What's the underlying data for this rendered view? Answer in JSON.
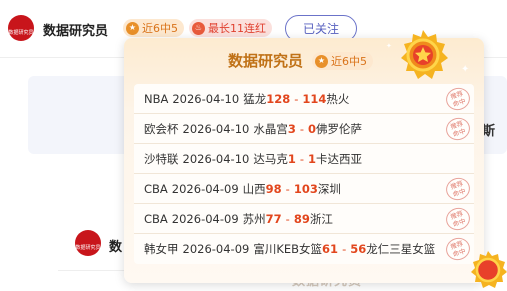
{
  "header": {
    "avatar_text": "数据研究员",
    "name": "数据研究员",
    "badge_win": "近6中5",
    "badge_streak": "最长11连红",
    "follow_label": "已关注"
  },
  "background": {
    "cut_text": "斯"
  },
  "popup": {
    "title": "数据研究员",
    "badge": "近6中5",
    "items": [
      {
        "league": "NBA",
        "date": "2026-04-10",
        "home": "猛龙",
        "hs": "128",
        "as": "114",
        "away": "热火",
        "stamp": "推荐命中"
      },
      {
        "league": "欧会杯",
        "date": "2026-04-10",
        "home": "水晶宫",
        "hs": "3",
        "as": "0",
        "away": "佛罗伦萨",
        "stamp": "推荐命中"
      },
      {
        "league": "沙特联",
        "date": "2026-04-10",
        "home": "达马克",
        "hs": "1",
        "as": "1",
        "away": "卡达西亚",
        "stamp": ""
      },
      {
        "league": "CBA",
        "date": "2026-04-09",
        "home": "山西",
        "hs": "98",
        "as": "103",
        "away": "深圳",
        "stamp": "推荐命中"
      },
      {
        "league": "CBA",
        "date": "2026-04-09",
        "home": "苏州",
        "hs": "77",
        "as": "89",
        "away": "浙江",
        "stamp": "推荐命中"
      },
      {
        "league": "韩女甲",
        "date": "2026-04-09",
        "home": "富川KEB女篮",
        "hs": "61",
        "as": "56",
        "away": "龙仁三星女篮",
        "stamp": "推荐命中"
      }
    ]
  },
  "row2": {
    "avatar_text": "数据研究员",
    "name": "数",
    "ghost": "数据研究员"
  },
  "colors": {
    "accent": "#e2461d",
    "gold": "#c07217",
    "follow": "#5861c0",
    "brand_red": "#c8151b"
  }
}
